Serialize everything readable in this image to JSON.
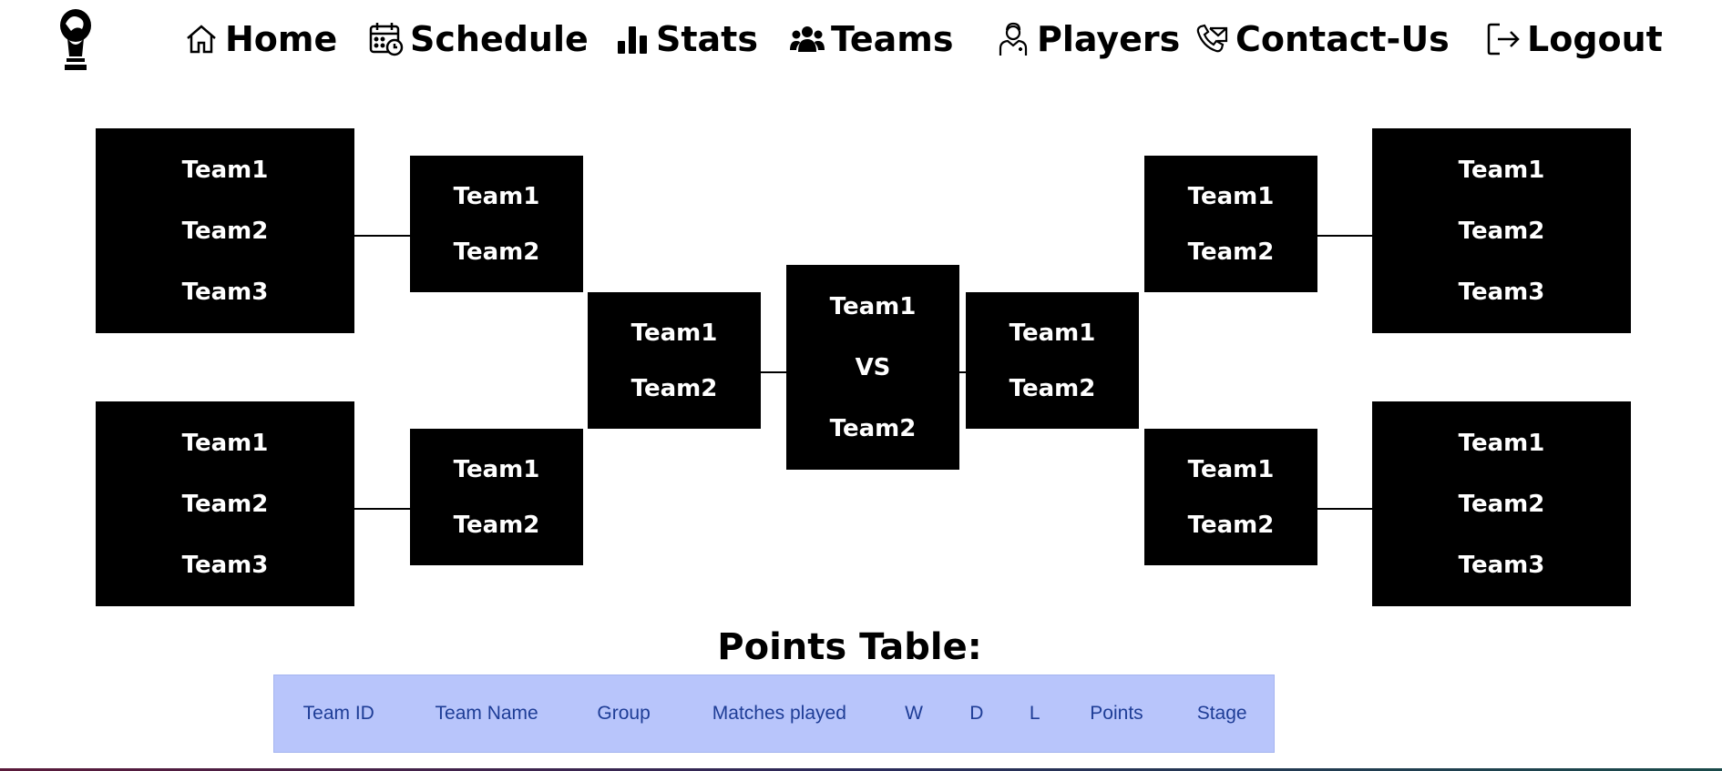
{
  "nav": {
    "items": [
      {
        "label": "Home",
        "icon": "home-icon"
      },
      {
        "label": "Schedule",
        "icon": "calendar-clock-icon"
      },
      {
        "label": "Stats",
        "icon": "bar-chart-icon"
      },
      {
        "label": "Teams",
        "icon": "users-icon"
      },
      {
        "label": "Players",
        "icon": "player-icon"
      },
      {
        "label": "Contact-Us",
        "icon": "phone-icon"
      },
      {
        "label": "Logout",
        "icon": "logout-icon"
      }
    ]
  },
  "bracket": {
    "left_top_group": [
      "Team1",
      "Team2",
      "Team3"
    ],
    "left_top_match": [
      "Team1",
      "Team2"
    ],
    "left_bottom_group": [
      "Team1",
      "Team2",
      "Team3"
    ],
    "left_bottom_match": [
      "Team1",
      "Team2"
    ],
    "left_semi": [
      "Team1",
      "Team2"
    ],
    "final": {
      "team_a": "Team1",
      "vs": "VS",
      "team_b": "Team2"
    },
    "right_semi": [
      "Team1",
      "Team2"
    ],
    "right_top_match": [
      "Team1",
      "Team2"
    ],
    "right_top_group": [
      "Team1",
      "Team2",
      "Team3"
    ],
    "right_bottom_match": [
      "Team1",
      "Team2"
    ],
    "right_bottom_group": [
      "Team1",
      "Team2",
      "Team3"
    ]
  },
  "points_table": {
    "title": "Points Table:",
    "columns": [
      "Team ID",
      "Team Name",
      "Group",
      "Matches played",
      "W",
      "D",
      "L",
      "Points",
      "Stage"
    ]
  }
}
